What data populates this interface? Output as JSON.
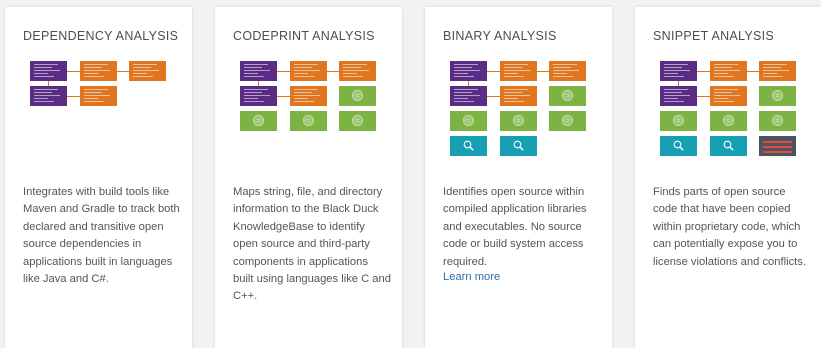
{
  "cards": [
    {
      "title": "DEPENDENCY ANALYSIS",
      "description": "Integrates with build tools like Maven and Gradle to track both declared and transitive open source dependencies in applications built in languages like Java and C#."
    },
    {
      "title": "CODEPRINT ANALYSIS",
      "description": "Maps string, file, and directory information to the Black Duck KnowledgeBase to identify open source and third-party components in applications built using languages like C and C++."
    },
    {
      "title": "BINARY ANALYSIS",
      "description": "Identifies open source within compiled application libraries and executables. No source code or build system access required.",
      "link": "Learn more"
    },
    {
      "title": "SNIPPET ANALYSIS",
      "description": "Finds parts of open source code that have been copied within proprietary code, which can potentially expose you to license violations and conflicts."
    }
  ],
  "colors": {
    "purple": "#5b2c86",
    "orange": "#e0761f",
    "green": "#7cb342",
    "teal": "#17a0b4",
    "gray": "#4a5561",
    "link": "#2e6fad"
  },
  "icons": {
    "fingerprint": "fingerprint-icon",
    "magnifier": "magnifier-icon",
    "code": "code-lines-icon"
  }
}
